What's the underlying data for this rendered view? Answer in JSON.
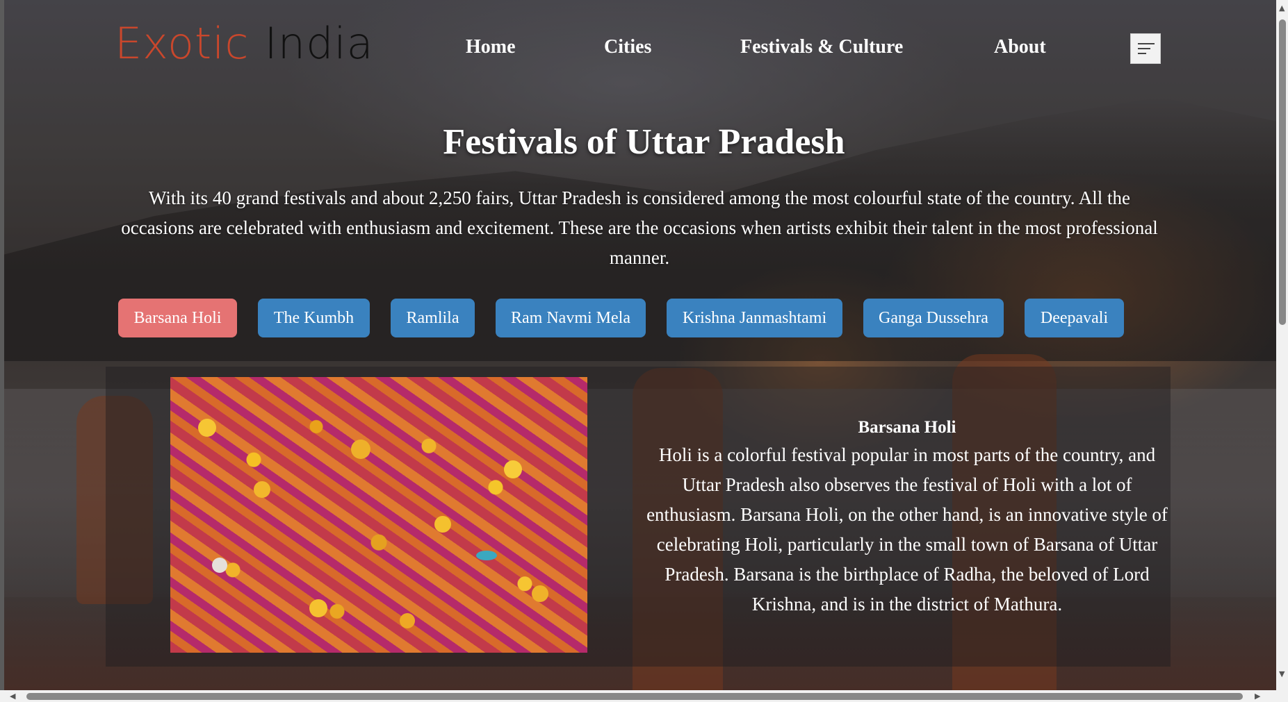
{
  "brand": {
    "word1": "Exotic",
    "word2": "India"
  },
  "nav": {
    "items": [
      {
        "label": "Home"
      },
      {
        "label": "Cities"
      },
      {
        "label": "Festivals & Culture"
      },
      {
        "label": "About"
      }
    ],
    "menu_icon": "hamburger-menu-icon"
  },
  "hero": {
    "title": "Festivals of Uttar Pradesh",
    "intro": "With its 40 grand festivals and about 2,250 fairs, Uttar Pradesh is considered among the most colourful state of the country. All the occasions are celebrated with enthusiasm and excitement. These are the occasions when artists exhibit their talent in the most professional manner."
  },
  "tabs": {
    "active_index": 0,
    "items": [
      {
        "label": "Barsana Holi"
      },
      {
        "label": "The Kumbh"
      },
      {
        "label": "Ramlila"
      },
      {
        "label": "Ram Navmi Mela"
      },
      {
        "label": "Krishna Janmashtami"
      },
      {
        "label": "Ganga Dussehra"
      },
      {
        "label": "Deepavali"
      }
    ]
  },
  "festival": {
    "title": "Barsana Holi",
    "description": "Holi is a colorful festival popular in most parts of the country, and Uttar Pradesh also observes the festival of Holi with a lot of enthusiasm. Barsana Holi, on the other hand, is an innovative style of celebrating Holi, particularly in the small town of Barsana of Uttar Pradesh. Barsana is the birthplace of Radha, the beloved of Lord Krishna, and is in the district of Mathura."
  },
  "colors": {
    "tab_active": "#e57373",
    "tab_default": "#3a82bf",
    "logo_accent": "#c9472c",
    "logo_dark": "#111111"
  }
}
